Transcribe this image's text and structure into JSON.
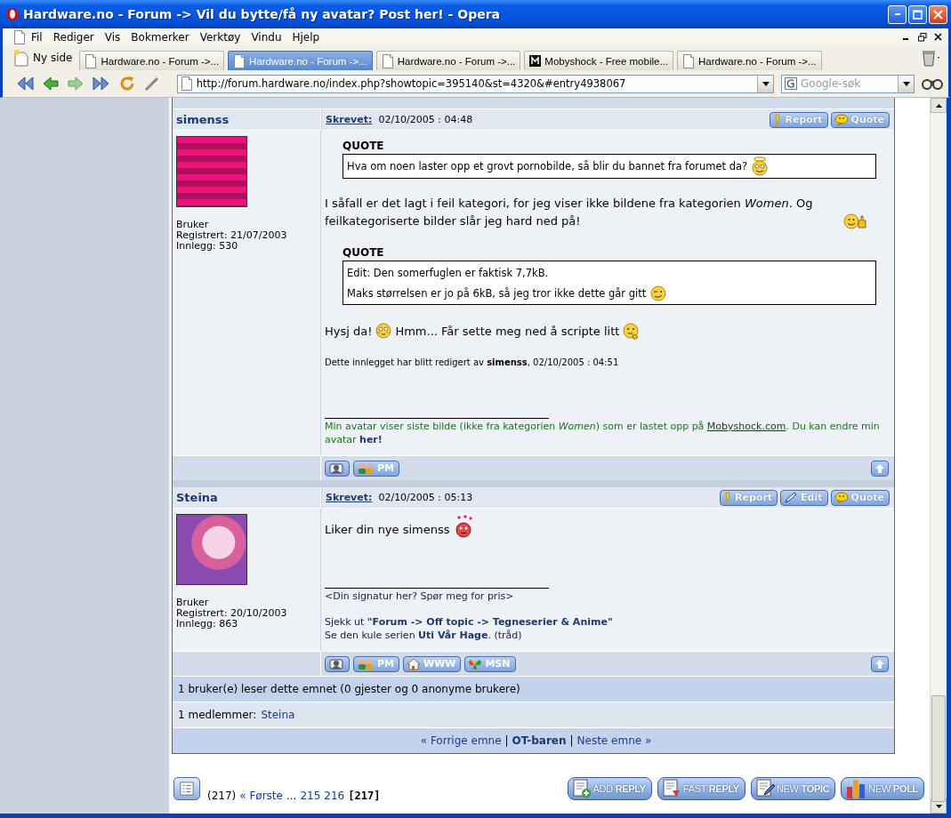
{
  "window": {
    "title": "Hardware.no - Forum -> Vil du bytte/få ny avatar? Post her! - Opera"
  },
  "menu": [
    "Fil",
    "Rediger",
    "Vis",
    "Bokmerker",
    "Verktøy",
    "Vindu",
    "Hjelp"
  ],
  "new_tab_button": "Ny side",
  "tabs": [
    {
      "label": "Hardware.no - Forum ->...",
      "selected": false,
      "kind": "page"
    },
    {
      "label": "Hardware.no - Forum ->...",
      "selected": true,
      "kind": "page"
    },
    {
      "label": "Hardware.no - Forum ->...",
      "selected": false,
      "kind": "page"
    },
    {
      "label": "Mobyshock - Free mobile...",
      "selected": false,
      "kind": "site"
    },
    {
      "label": "Hardware.no - Forum ->...",
      "selected": false,
      "kind": "page"
    }
  ],
  "address": {
    "url": "http://forum.hardware.no/index.php?showtopic=395140&st=4320&#entry4938067"
  },
  "search": {
    "placeholder": "Google-søk"
  },
  "posts": [
    {
      "author": "simenss",
      "written_label": "Skrevet:",
      "date": "02/10/2005 : 04:48",
      "avatar": {
        "kind": "banner"
      },
      "rank": "Bruker",
      "registered": "Registrert: 21/07/2003",
      "post_count": "Innlegg: 530",
      "actions": [
        {
          "kind": "report",
          "label": "Report"
        },
        {
          "kind": "quote",
          "label": "Quote"
        }
      ],
      "body": [
        {
          "kind": "quote",
          "label": "QUOTE",
          "lines": [
            [
              {
                "kind": "text",
                "text": "Hva om noen laster opp et grovt pornobilde, så blir du bannet fra forumet da?"
              },
              {
                "kind": "angel"
              }
            ]
          ]
        },
        {
          "kind": "paragraph",
          "parts": [
            {
              "kind": "text",
              "text": "I såfall er det lagt i feil kategori, for jeg viser ikke bildene fra kategorien *Women*. Og feilkategoriserte bilder slår jeg hard ned på!"
            },
            {
              "kind": "thumbs"
            }
          ]
        },
        {
          "kind": "quote",
          "label": "QUOTE",
          "lines": [
            [
              {
                "kind": "text",
                "text": "Edit: Den somerfuglen er faktisk 7,7kB."
              }
            ],
            [
              {
                "kind": "text",
                "text": "Maks størrelsen er jo på 6kB, så jeg tror ikke dette går gitt"
              },
              {
                "kind": "wink"
              }
            ]
          ]
        },
        {
          "kind": "paragraph",
          "parts": [
            {
              "kind": "text",
              "text": "Hysj da!"
            },
            {
              "kind": "blush"
            },
            {
              "kind": "text",
              "text": "Hmm... Får sette meg ned å scripte litt"
            },
            {
              "kind": "thinking"
            }
          ]
        },
        {
          "kind": "edit_note",
          "text": "Dette innlegget har blitt redigert av **simenss**, 02/10/2005 : 04:51"
        }
      ],
      "signature": [
        [
          [
            {
              "kind": "text",
              "text": "Min avatar viser siste bilde (ikke fra kategorien *Women*) som er lastet opp på "
            },
            {
              "kind": "link",
              "text": "Mobyshock.com"
            },
            {
              "kind": "text",
              "text": ". Du kan endre min avatar "
            },
            {
              "kind": "strong_link",
              "text": "her!"
            }
          ]
        ]
      ],
      "tools": [
        {
          "kind": "profile"
        },
        {
          "kind": "pm",
          "label": "PM"
        }
      ]
    },
    {
      "author": "Steina",
      "written_label": "Skrevet:",
      "date": "02/10/2005 : 05:13",
      "avatar": {
        "kind": "portrait"
      },
      "rank": "Bruker",
      "registered": "Registrert: 20/10/2003",
      "post_count": "Innlegg: 863",
      "actions": [
        {
          "kind": "report",
          "label": "Report"
        },
        {
          "kind": "edit",
          "label": "Edit"
        },
        {
          "kind": "quote",
          "label": "Quote"
        }
      ],
      "body": [
        {
          "kind": "paragraph",
          "parts": [
            {
              "kind": "text",
              "text": "Liker din nye simenss"
            },
            {
              "kind": "love"
            }
          ]
        }
      ],
      "signature": [
        [
          [
            {
              "kind": "text",
              "text": "<Din signatur her? Spør meg for pris>"
            }
          ]
        ],
        [
          [
            {
              "kind": "text",
              "text": "Sjekk ut **\"Forum -> Off topic -> Tegneserier & Anime\"**"
            }
          ],
          [
            {
              "kind": "text",
              "text": "Se den kule serien **Uti Vår Hage**. (tråd)"
            }
          ]
        ]
      ],
      "tools": [
        {
          "kind": "profile"
        },
        {
          "kind": "pm",
          "label": "PM"
        },
        {
          "kind": "www",
          "label": "WWW"
        },
        {
          "kind": "msn",
          "label": "MSN"
        }
      ]
    }
  ],
  "online": {
    "text": "1 bruker(e) leser dette emnet (0 gjester og 0 anonyme brukere)",
    "members_label": "1 medlemmer:",
    "members": [
      "Steina"
    ]
  },
  "topic_nav": [
    {
      "kind": "link",
      "text": "« Forrige emne"
    },
    {
      "kind": "sep",
      "text": "|"
    },
    {
      "kind": "strong_link",
      "text": "OT-baren"
    },
    {
      "kind": "sep",
      "text": "|"
    },
    {
      "kind": "link",
      "text": "Neste emne »"
    }
  ],
  "pager": {
    "count": "(217)",
    "items": [
      {
        "kind": "link",
        "text": "« Første"
      },
      {
        "kind": "text",
        "text": "..."
      },
      {
        "kind": "link",
        "text": "215"
      },
      {
        "kind": "link",
        "text": "216"
      },
      {
        "kind": "current",
        "text": "[217]"
      }
    ]
  },
  "topic_buttons": [
    {
      "kind": "add",
      "label": "ADD **REPLY**"
    },
    {
      "kind": "fast",
      "label": "FAST **REPLY**"
    },
    {
      "kind": "topic",
      "label": "NEW **TOPIC**"
    },
    {
      "kind": "poll",
      "label": "NEW **POLL**"
    }
  ]
}
